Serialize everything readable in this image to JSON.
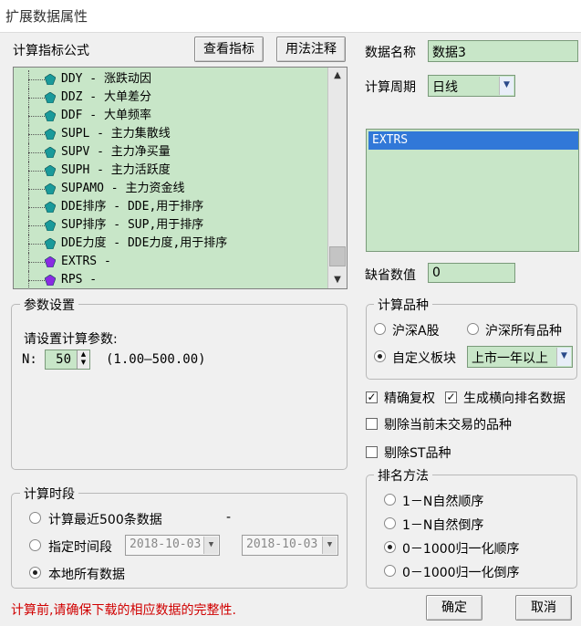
{
  "window": {
    "title": "扩展数据属性"
  },
  "formula": {
    "label": "计算指标公式",
    "view_button": "查看指标",
    "usage_button": "用法注释",
    "items": [
      "DDY - 涨跌动因",
      "DDZ - 大单差分",
      "DDF - 大单频率",
      "SUPL - 主力集散线",
      "SUPV - 主力净买量",
      "SUPH - 主力活跃度",
      "SUPAMO - 主力资金线",
      "DDE排序 - DDE,用于排序",
      "SUP排序 - SUP,用于排序",
      "DDE力度 - DDE力度,用于排序",
      "EXTRS -",
      "RPS -"
    ],
    "gem_colors": {
      "normal": "#1a9a9a",
      "user": "#8a2be2"
    }
  },
  "params": {
    "group_title": "参数设置",
    "prompt": "请设置计算参数:",
    "n_label": "N:",
    "n_value": "50",
    "n_range": "(1.00—500.00)"
  },
  "period": {
    "group_title": "计算时段",
    "opt_recent": "计算最近500条数据",
    "opt_range": "指定时间段",
    "opt_all": "本地所有数据",
    "date_from": "2018-10-03",
    "date_to": "2018-10-03",
    "dash": "-"
  },
  "right": {
    "name_label": "数据名称",
    "name_value": "数据3",
    "cycle_label": "计算周期",
    "cycle_value": "日线",
    "list_selected": "EXTRS",
    "missing_label": "缺省数值",
    "missing_value": "0"
  },
  "variety": {
    "group_title": "计算品种",
    "opt_a": "沪深A股",
    "opt_all": "沪深所有品种",
    "opt_custom": "自定义板块",
    "custom_value": "上市一年以上"
  },
  "checks": {
    "exact_rights": "精确复权",
    "gen_rank": "生成横向排名数据",
    "exclude_untraded": "剔除当前未交易的品种",
    "exclude_st": "剔除ST品种"
  },
  "rank": {
    "group_title": "排名方法",
    "opt1": "1－N自然顺序",
    "opt2": "1－N自然倒序",
    "opt3": "0－1000归一化顺序",
    "opt4": "0－1000归一化倒序"
  },
  "footer": {
    "warning": "计算前,请确保下载的相应数据的完整性.",
    "ok": "确定",
    "cancel": "取消"
  },
  "colors": {
    "field_bg": "#c8e6c8",
    "warning": "#d00000",
    "selection": "#3178d8"
  }
}
